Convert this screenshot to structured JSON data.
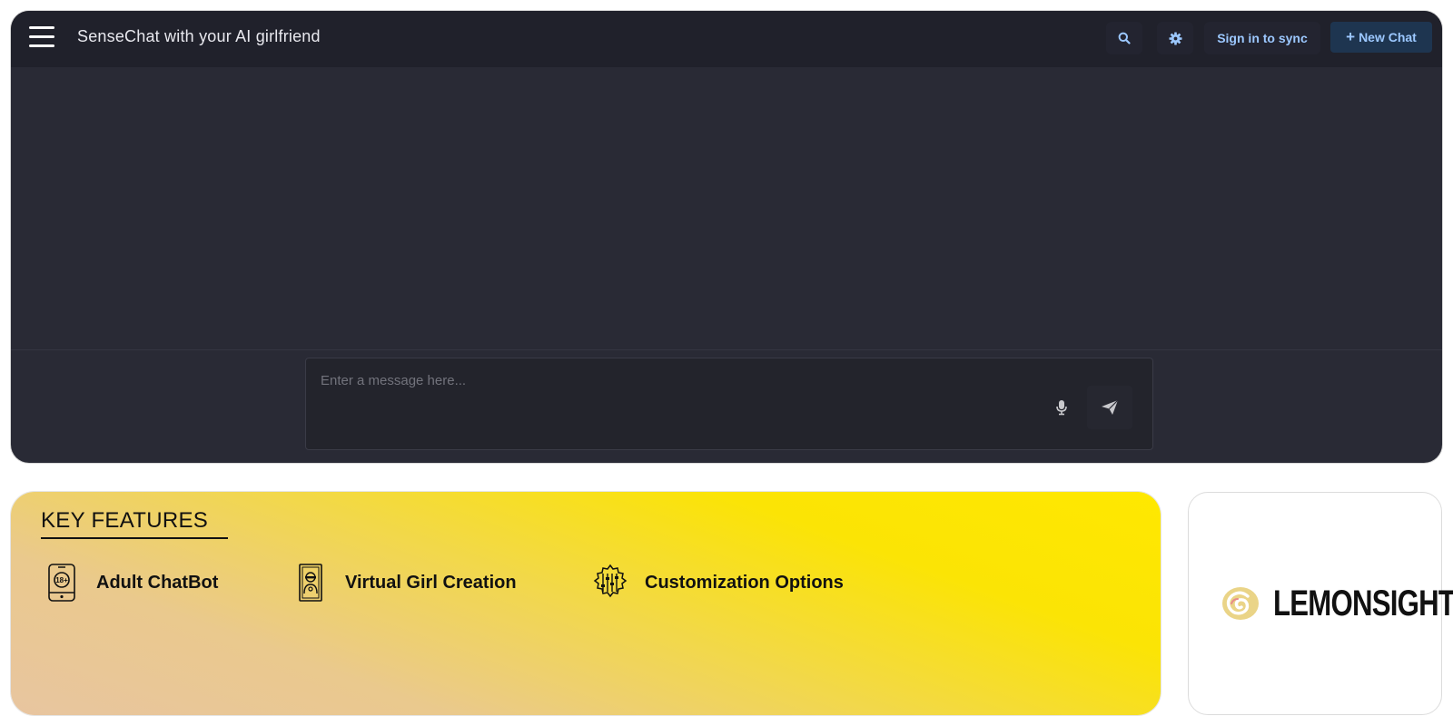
{
  "header": {
    "title": "SenseChat with your AI girlfriend",
    "sign_in_label": "Sign in to sync",
    "new_chat_label": "New Chat",
    "new_chat_icon": "plus-icon",
    "search_icon": "search-icon",
    "settings_icon": "gear-icon",
    "menu_icon": "hamburger-menu-icon"
  },
  "composer": {
    "placeholder": "Enter a message here...",
    "mic_icon": "microphone-icon",
    "send_icon": "send-icon"
  },
  "features": {
    "title": "KEY FEATURES",
    "items": [
      {
        "label": "Adult ChatBot",
        "icon": "18-plus-phone-icon"
      },
      {
        "label": "Virtual Girl Creation",
        "icon": "girl-portrait-icon"
      },
      {
        "label": "Customization Options",
        "icon": "sliders-gear-icon"
      }
    ]
  },
  "sponsor": {
    "brand": "LEMONSIGHT",
    "logo_icon": "lemon-spiral-logo-icon"
  },
  "colors": {
    "app_bg": "#292a35",
    "topbar_bg": "#20212b",
    "accent_text": "#9cc8ff",
    "new_chat_bg": "#1e3550",
    "features_yellow": "#ffe800"
  }
}
